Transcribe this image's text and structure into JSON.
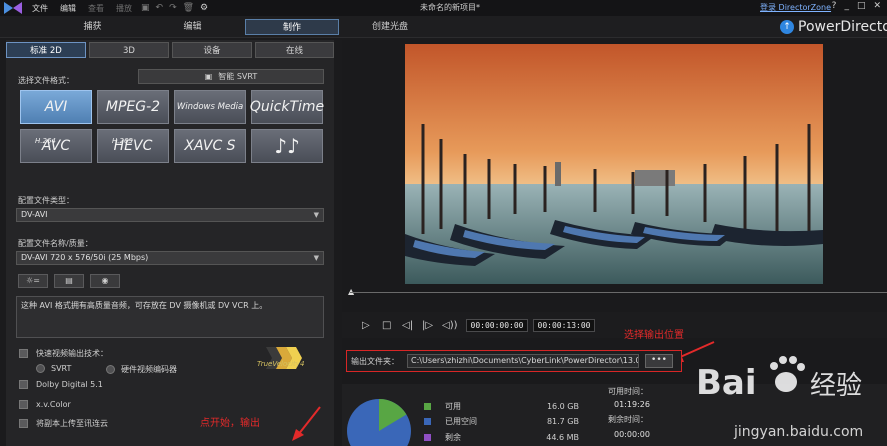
{
  "titlebar": {
    "menu": [
      {
        "label": "文件",
        "dim": false
      },
      {
        "label": "编辑",
        "dim": false
      },
      {
        "label": "查看",
        "dim": true
      },
      {
        "label": "播放",
        "dim": true
      }
    ],
    "project_title": "未命名的新项目*",
    "signin": "登录 DirectorZone",
    "help": "?"
  },
  "main_tabs": [
    "捕获",
    "编辑",
    "制作",
    "创建光盘"
  ],
  "brand": "PowerDirector",
  "sub_tabs": [
    "标准 2D",
    "3D",
    "设备",
    "在线"
  ],
  "format_label": "选择文件格式：",
  "svrt_label": "智能 SVRT",
  "formats": [
    {
      "label": "AVI",
      "sup": ""
    },
    {
      "label": "MPEG-2",
      "sup": ""
    },
    {
      "label": "Windows Media",
      "sup": ""
    },
    {
      "label": "QuickTime",
      "sup": ""
    },
    {
      "label": "AVC",
      "sup": "H.264"
    },
    {
      "label": "HEVC",
      "sup": "H.265"
    },
    {
      "label": "XAVC S",
      "sup": ""
    },
    {
      "label": "♪♪",
      "sup": ""
    }
  ],
  "profile_type_label": "配置文件类型：",
  "profile_type_value": "DV-AVI",
  "profile_name_label": "配置文件名称/质量：",
  "profile_name_value": "DV-AVI 720 x 576/50i (25 Mbps)",
  "description": "这种 AVI 格式拥有高质量音频，可存放在 DV 摄像机或 DV VCR 上。",
  "fast_render_label": "快速视频输出技术：",
  "svrt_radio": "SVRT",
  "hw_encoder_radio": "硬件视频编码器",
  "truevelocity": "TrueVelocity4",
  "dolby_label": "Dolby Digital 5.1",
  "xvcolor_label": "x.v.Color",
  "upload_label": "将副本上传至讯连云",
  "annotation_start": "点开始，输出",
  "annotation_output": "选择输出位置",
  "timecode_current": "00:00:00:00",
  "timecode_total": "00:00:13:00",
  "output_folder_label": "输出文件夹：",
  "output_folder_path": "C:\\Users\\zhizhi\\Documents\\CyberLink\\PowerDirector\\13.0\\",
  "browse_label": "•••",
  "disk": {
    "available_label": "可用",
    "available_value": "16.0  GB",
    "used_label": "已用空间",
    "used_value": "81.7  GB",
    "remaining_label": "剩余",
    "remaining_value": "44.6  MB",
    "available_time_label": "可用时间：",
    "available_time_value": "01:19:26",
    "remaining_time_label": "剩余时间：",
    "remaining_time_value": "00:00:00"
  },
  "watermark": {
    "brand": "Bai",
    "jingyan": "经验",
    "url": "jingyan.baidu.com"
  },
  "colors": {
    "accent": "#2f86e0",
    "available": "#58a644",
    "used": "#3a67b8",
    "remaining": "#8f4fc4",
    "annotation": "#e32a2a"
  }
}
